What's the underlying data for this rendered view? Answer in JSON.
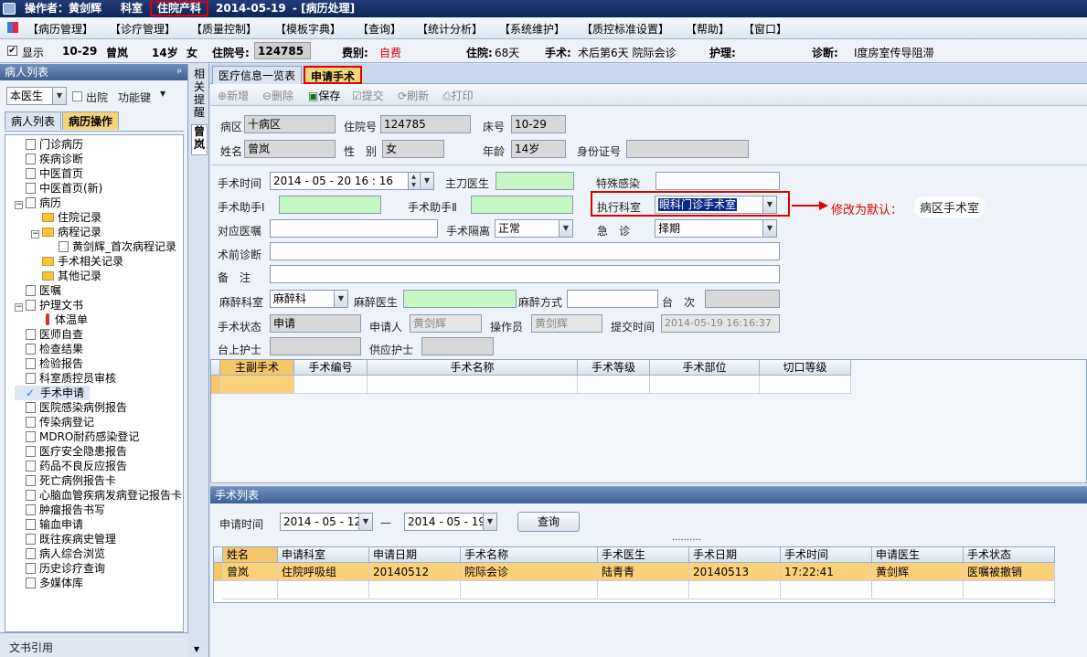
{
  "title": {
    "operator_label": "操作者：黄剑辉",
    "dept_label": "科室",
    "dept_value": "住院产科",
    "date": "2014-05-19",
    "module": "- [病历处理]"
  },
  "menu": [
    "【病历管理】",
    "【诊疗管理】",
    "【质量控制】",
    "【模板字典】",
    "【查询】",
    "【统计分析】",
    "【系统维护】",
    "【质控标准设置】",
    "【帮助】",
    "【窗口】"
  ],
  "patient": {
    "display_label": "显示",
    "bed": "10-29",
    "name": "曾岚",
    "age": "14岁",
    "sex": "女",
    "inpatient_no_label": "住院号:",
    "inpatient_no": "124785",
    "fee_label": "费别:",
    "fee_value": "自费",
    "stay_label": "住院:",
    "stay_value": "68天",
    "surgery_label": "手术:",
    "surgery_value": "术后第6天 院际会诊",
    "care_label": "护理:",
    "diagnosis_label": "诊断:",
    "diagnosis_value": "Ⅰ度房室传导阻滞"
  },
  "left": {
    "panel_title": "病人列表",
    "pin": "ᵖ",
    "doctor_select": "本医生",
    "discharged_label": "出院",
    "function_key": "功能键",
    "tab_patient_list": "病人列表",
    "tab_record_ops": "病历操作",
    "tree": [
      {
        "label": "门诊病历",
        "level": 0,
        "kind": "doc"
      },
      {
        "label": "疾病诊断",
        "level": 0,
        "kind": "doc"
      },
      {
        "label": "中医首页",
        "level": 0,
        "kind": "doc"
      },
      {
        "label": "中医首页(新)",
        "level": 0,
        "kind": "doc"
      },
      {
        "label": "病历",
        "level": 0,
        "kind": "doc",
        "toggle": "−"
      },
      {
        "label": "住院记录",
        "level": 1,
        "kind": "folder"
      },
      {
        "label": "病程记录",
        "level": 1,
        "kind": "folder",
        "toggle": "−"
      },
      {
        "label": "黄剑辉_首次病程记录",
        "level": 2,
        "kind": "doc"
      },
      {
        "label": "手术相关记录",
        "level": 1,
        "kind": "folder"
      },
      {
        "label": "其他记录",
        "level": 1,
        "kind": "folder"
      },
      {
        "label": "医嘱",
        "level": 0,
        "kind": "doc"
      },
      {
        "label": "护理文书",
        "level": 0,
        "kind": "doc",
        "toggle": "−"
      },
      {
        "label": "体温单",
        "level": 1,
        "kind": "thermo"
      },
      {
        "label": "医师自查",
        "level": 0,
        "kind": "doc"
      },
      {
        "label": "检查结果",
        "level": 0,
        "kind": "doc"
      },
      {
        "label": "检验报告",
        "level": 0,
        "kind": "doc"
      },
      {
        "label": "科室质控员审核",
        "level": 0,
        "kind": "doc"
      },
      {
        "label": "手术申请",
        "level": 0,
        "kind": "check"
      },
      {
        "label": "医院感染病例报告",
        "level": 0,
        "kind": "doc"
      },
      {
        "label": "传染病登记",
        "level": 0,
        "kind": "doc"
      },
      {
        "label": "MDRO耐药感染登记",
        "level": 0,
        "kind": "doc"
      },
      {
        "label": "医疗安全隐患报告",
        "level": 0,
        "kind": "doc"
      },
      {
        "label": "药品不良反应报告",
        "level": 0,
        "kind": "doc"
      },
      {
        "label": "死亡病例报告卡",
        "level": 0,
        "kind": "doc"
      },
      {
        "label": "心脑血管疾病发病登记报告卡",
        "level": 0,
        "kind": "doc"
      },
      {
        "label": "肿瘤报告书写",
        "level": 0,
        "kind": "doc"
      },
      {
        "label": "输血申请",
        "level": 0,
        "kind": "doc"
      },
      {
        "label": "既往疾病史管理",
        "level": 0,
        "kind": "doc"
      },
      {
        "label": "病人综合浏览",
        "level": 0,
        "kind": "doc"
      },
      {
        "label": "历史诊疗查询",
        "level": 0,
        "kind": "doc"
      },
      {
        "label": "多媒体库",
        "level": 0,
        "kind": "doc"
      }
    ],
    "footer": "文书引用"
  },
  "vtabs": {
    "tab1": "相关提醒",
    "tab2": "曾岚"
  },
  "tabs": {
    "tab1": "医疗信息一览表",
    "tab2": "申请手术"
  },
  "toolbar": {
    "new": "新增",
    "delete": "删除",
    "save": "保存",
    "submit": "提交",
    "refresh": "刷新",
    "print": "打印"
  },
  "form": {
    "ward_label": "病区",
    "ward_value": "十病区",
    "inpatient_no_label": "住院号",
    "inpatient_no_value": "124785",
    "bed_label": "床号",
    "bed_value": "10-29",
    "name_label": "姓名",
    "name_value": "曾岚",
    "sex_label": "性　别",
    "sex_value": "女",
    "age_label": "年龄",
    "age_value": "14岁",
    "id_label": "身份证号",
    "id_value": "",
    "surgery_time_label": "手术时间",
    "surgery_time_value": "2014 - 05 - 20   16 : 16",
    "chief_surgeon_label": "主刀医生",
    "special_infection_label": "特殊感染",
    "assistant1_label": "手术助手Ⅰ",
    "assistant2_label": "手术助手Ⅱ",
    "exec_dept_label": "执行科室",
    "exec_dept_value": "眼科门诊手术室",
    "order_label": "对应医嘱",
    "isolation_label": "手术隔离",
    "isolation_value": "正常",
    "urgent_label": "急　诊",
    "urgent_value": "择期",
    "pre_diag_label": "术前诊断",
    "remark_label": "备　注",
    "anes_dept_label": "麻醉科室",
    "anes_dept_value": "麻醉科",
    "anes_doctor_label": "麻醉医生",
    "anes_method_label": "麻醉方式",
    "sequence_label": "台　次",
    "status_label": "手术状态",
    "status_value": "申请",
    "applicant_label": "申请人",
    "applicant_value": "黄剑辉",
    "operator_label": "操作员",
    "operator_value": "黄剑辉",
    "submit_time_label": "提交时间",
    "submit_time_value": "2014-05-19 16:16:37",
    "table_nurse_label": "台上护士",
    "supply_nurse_label": "供应护士"
  },
  "annotation": {
    "text": "修改为默认：",
    "highlight": "病区手术室"
  },
  "surgery_grid": {
    "headers": [
      "主副手术",
      "手术编号",
      "手术名称",
      "手术等级",
      "手术部位",
      "切口等级"
    ]
  },
  "surgery_list": {
    "panel_title": "手术列表",
    "apply_time_label": "申请时间",
    "date_from": "2014 - 05 - 12",
    "date_sep": "—",
    "date_to": "2014 - 05 - 19",
    "query_button": "查询",
    "splitter": "..........",
    "headers": [
      "姓名",
      "申请科室",
      "申请日期",
      "手术名称",
      "手术医生",
      "手术日期",
      "手术时间",
      "申请医生",
      "手术状态"
    ],
    "rows": [
      [
        "曾岚",
        "住院呼吸组",
        "20140512",
        "院际会诊",
        "陆青青",
        "20140513",
        "17:22:41",
        "黄剑辉",
        "医嘱被撤销"
      ]
    ]
  },
  "colors": {
    "title_bg": "#0d2557",
    "tab_active": "#f5d47b",
    "highlight_row": "#fbd27a",
    "required_field": "#c4f7c4",
    "annotation_red": "#e00000"
  }
}
